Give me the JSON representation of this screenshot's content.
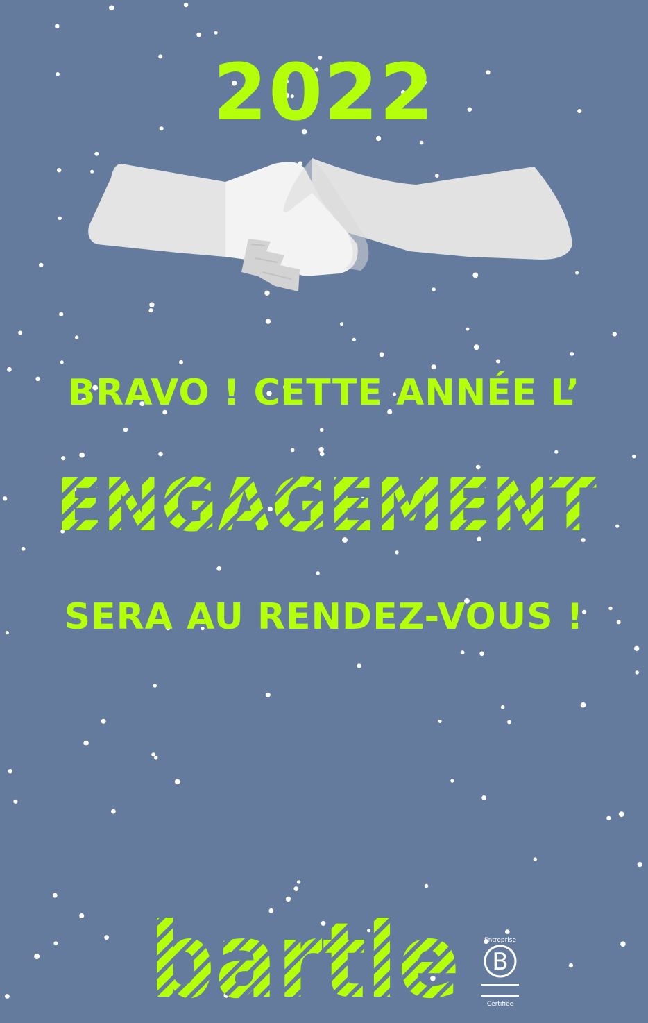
{
  "card": {
    "year": "2022",
    "line1": "BRAVO ! CETTE ANNÉE L’",
    "highlight": "ENGAGEMENT",
    "line3": "SERA AU RENDEZ-VOUS !",
    "brand": "bartle",
    "certification": {
      "top_label": "Entreprise",
      "letter": "B",
      "bottom_label": "Certifiée"
    }
  },
  "colors": {
    "background": "#657b9d",
    "accent": "#b4ff0a",
    "hand_light": "#f2f2f2",
    "hand_mid": "#e4e4e4",
    "hand_dark": "#d6d6d6",
    "snow": "#ffffff"
  },
  "icons": [
    "handshake-icon",
    "b-corp-badge-icon"
  ]
}
